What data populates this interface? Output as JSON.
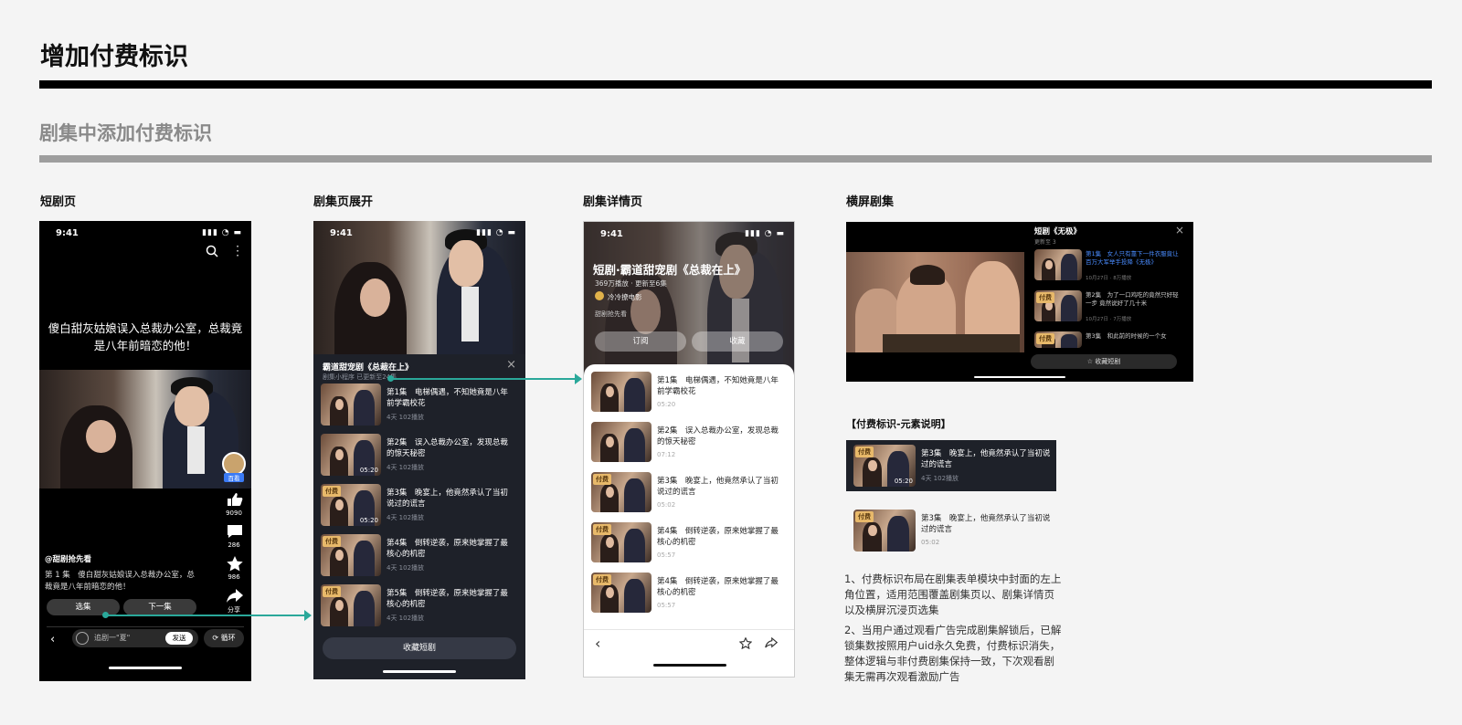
{
  "header": {
    "title": "增加付费标识",
    "section": "剧集中添加付费标识"
  },
  "columns": {
    "c1": "短剧页",
    "c2": "剧集页展开",
    "c3": "剧集详情页",
    "c4": "横屏剧集"
  },
  "status": {
    "time": "9:41"
  },
  "phone1": {
    "caption": "傻白甜灰姑娘误入总裁办公室，总裁竟是八年前暗恋的他！",
    "follow": "百看",
    "likes": "9090",
    "comments": "286",
    "favorites": "986",
    "share": "分享",
    "author": "@甜剧抢先看",
    "desc": "第 1 集　傻白甜灰姑娘误入总裁办公室，总裁竟是八年前暗恋的他！",
    "btn_select": "选集",
    "btn_next": "下一集",
    "input_placeholder": "追剧一\"夏\"",
    "send": "发送",
    "loop": "循环"
  },
  "phone2": {
    "panel_title": "霸道甜宠剧《总裁在上》",
    "panel_sub": "剧集小程序 已更新至24集",
    "episodes": [
      {
        "title": "第1集　电梯偶遇，不知她竟是八年前学霸校花",
        "meta": "4天 102播放",
        "paid": false,
        "dur": ""
      },
      {
        "title": "第2集　误入总裁办公室，发现总裁的惊天秘密",
        "meta": "4天 102播放",
        "paid": false,
        "dur": "05:20"
      },
      {
        "title": "第3集　晚宴上，他竟然承认了当初说过的谎言",
        "meta": "4天 102播放",
        "paid": true,
        "dur": "05:20"
      },
      {
        "title": "第4集　倒转逆袭，原来她掌握了最核心的机密",
        "meta": "4天 102播放",
        "paid": true,
        "dur": ""
      },
      {
        "title": "第5集　倒转逆袭，原来她掌握了最核心的机密",
        "meta": "4天 102播放",
        "paid": true,
        "dur": ""
      }
    ],
    "collect": "收藏短剧",
    "paid_badge": "付费"
  },
  "phone3": {
    "title": "短剧·霸道甜宠剧《总裁在上》",
    "sub": "369万播放 · 更新至6集",
    "author": "冷冷撩电影",
    "intro": "甜剧抢先看",
    "subscribe": "订阅",
    "collect": "收藏",
    "episodes": [
      {
        "title": "第1集　电梯偶遇，不知她竟是八年前学霸校花",
        "meta": "05:20",
        "paid": false
      },
      {
        "title": "第2集　误入总裁办公室，发现总裁的惊天秘密",
        "meta": "07:12",
        "paid": false
      },
      {
        "title": "第3集　晚宴上，他竟然承认了当初说过的谎言",
        "meta": "05:02",
        "paid": true
      },
      {
        "title": "第4集　倒转逆袭，原来她掌握了最核心的机密",
        "meta": "05:57",
        "paid": true
      },
      {
        "title": "第4集　倒转逆袭，原来她掌握了最核心的机密",
        "meta": "05:57",
        "paid": true
      }
    ]
  },
  "landscape": {
    "title": "短剧《无极》",
    "sub": "更新至 3",
    "items": [
      {
        "title": "第1集　女人只有靠下一件衣服竟让百万大军举手投降《无极》",
        "meta": "10月27日 · 8万播放"
      },
      {
        "title": "第2集　为了一口鸡吃的竟然只好轻一步 竟然说好了几十米",
        "meta": "10月27日 · 7万播放"
      },
      {
        "title": "第3集　和此前的时候的一个女",
        "meta": ""
      }
    ],
    "collect": "收藏短剧"
  },
  "legend": {
    "title": "【付费标识-元素说明】",
    "sample1_title": "第3集　晚宴上，他竟然承认了当初说过的谎言",
    "sample1_meta": "4天 102播放",
    "sample1_dur": "05:20",
    "sample2_title": "第3集　晚宴上，他竟然承认了当初说过的谎言",
    "sample2_meta": "05:02"
  },
  "notes": {
    "n1": "1、付费标识布局在剧集表单模块中封面的左上角位置，适用范围覆盖剧集页以、剧集详情页以及横屏沉浸页选集",
    "n2": "2、当用户通过观看广告完成剧集解锁后，已解锁集数按照用户uid永久免费，付费标识消失，整体逻辑与非付费剧集保持一致，下次观看剧集无需再次观看激励广告"
  },
  "colors": {
    "accent": "#2aa89a",
    "badge": "#e8b96a",
    "panel": "#1e2129"
  }
}
